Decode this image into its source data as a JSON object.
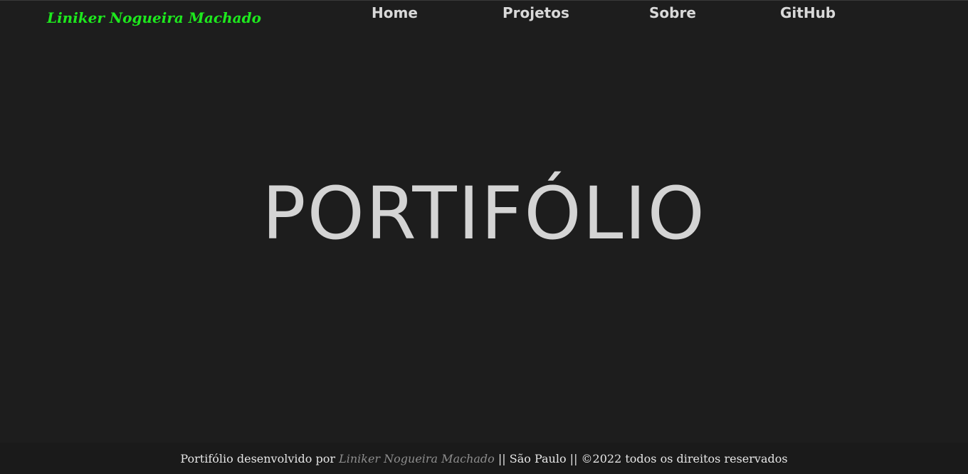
{
  "header": {
    "brand": "Liniker Nogueira Machado",
    "nav": [
      "Home",
      "Projetos",
      "Sobre",
      "GitHub"
    ]
  },
  "hero": {
    "title": "PORTIFÓLIO"
  },
  "footer": {
    "prefix": "Portifólio desenvolvido por ",
    "author": "Liniker Nogueira Machado",
    "suffix": " || São Paulo || ©2022 todos os direitos reservados"
  },
  "colors": {
    "background": "#1d1d1d",
    "brand": "#1ee81e",
    "text": "#d4d4d4",
    "author_link": "#8d8d8d"
  }
}
